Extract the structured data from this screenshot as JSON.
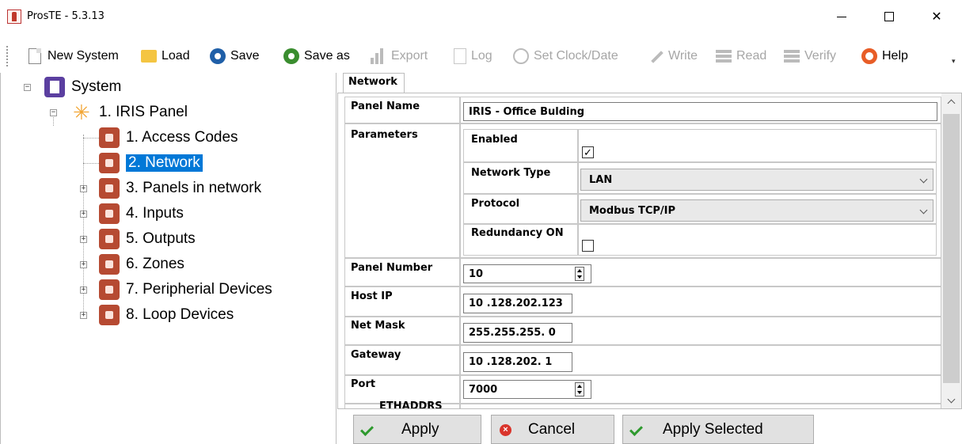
{
  "window": {
    "title": "ProsTE - 5.3.13",
    "close_glyph": "✕"
  },
  "toolbar": {
    "items": [
      {
        "label": "New System",
        "icon": "new-document-icon",
        "enabled": true
      },
      {
        "label": "Load",
        "icon": "folder-icon",
        "enabled": true
      },
      {
        "label": "Save",
        "icon": "save-disk-icon",
        "enabled": true
      },
      {
        "label": "Save as",
        "icon": "save-as-disk-icon",
        "enabled": true
      },
      {
        "label": "Export",
        "icon": "export-bars-icon",
        "enabled": false
      },
      {
        "label": "Log",
        "icon": "log-icon",
        "enabled": false
      },
      {
        "label": "Set Clock/Date",
        "icon": "clock-icon",
        "enabled": false
      },
      {
        "label": "Write",
        "icon": "pencil-icon",
        "enabled": false
      },
      {
        "label": "Read",
        "icon": "read-stack-icon",
        "enabled": false
      },
      {
        "label": "Verify",
        "icon": "verify-stack-icon",
        "enabled": false
      },
      {
        "label": "Help",
        "icon": "help-lifebuoy-icon",
        "enabled": true
      }
    ],
    "overflow_glyph": "▾"
  },
  "tree": {
    "root": {
      "label": "System",
      "expander": "−"
    },
    "panel": {
      "label": "1. IRIS Panel",
      "expander": "−"
    },
    "children": [
      {
        "label": "1. Access Codes",
        "expander": ""
      },
      {
        "label": "2. Network",
        "expander": "",
        "selected": true
      },
      {
        "label": "3. Panels in network",
        "expander": "+"
      },
      {
        "label": "4. Inputs",
        "expander": "+"
      },
      {
        "label": "5. Outputs",
        "expander": "+"
      },
      {
        "label": "6. Zones",
        "expander": "+"
      },
      {
        "label": "7. Peripherial Devices",
        "expander": "+"
      },
      {
        "label": "8. Loop Devices",
        "expander": "+"
      }
    ]
  },
  "tab": {
    "label": "Network"
  },
  "form": {
    "panel_name": {
      "label": "Panel Name",
      "value": "IRIS - Office Bulding"
    },
    "parameters": {
      "label": "Parameters",
      "enabled": {
        "label": "Enabled",
        "checked": true,
        "glyph": "✓"
      },
      "network_type": {
        "label": "Network Type",
        "value": "LAN"
      },
      "protocol": {
        "label": "Protocol",
        "value": "Modbus TCP/IP"
      },
      "redundancy": {
        "label": "Redundancy ON",
        "checked": false,
        "glyph": ""
      }
    },
    "panel_number": {
      "label": "Panel Number",
      "value": "10"
    },
    "host_ip": {
      "label": "Host IP",
      "value": "10 .128.202.123"
    },
    "net_mask": {
      "label": "Net Mask",
      "value": "255.255.255.  0"
    },
    "gateway": {
      "label": "Gateway",
      "value": "10 .128.202.  1"
    },
    "port": {
      "label": "Port",
      "value": "7000"
    },
    "partial_row": {
      "label": "ETHADDRS"
    }
  },
  "buttons": {
    "apply": "Apply",
    "cancel": "Cancel",
    "apply_selected": "Apply Selected"
  },
  "colors": {
    "selection": "#0078d7",
    "tree_item_icon": "#b64a32",
    "system_icon": "#5b3fa0",
    "disabled_text": "#a6a6a6"
  }
}
